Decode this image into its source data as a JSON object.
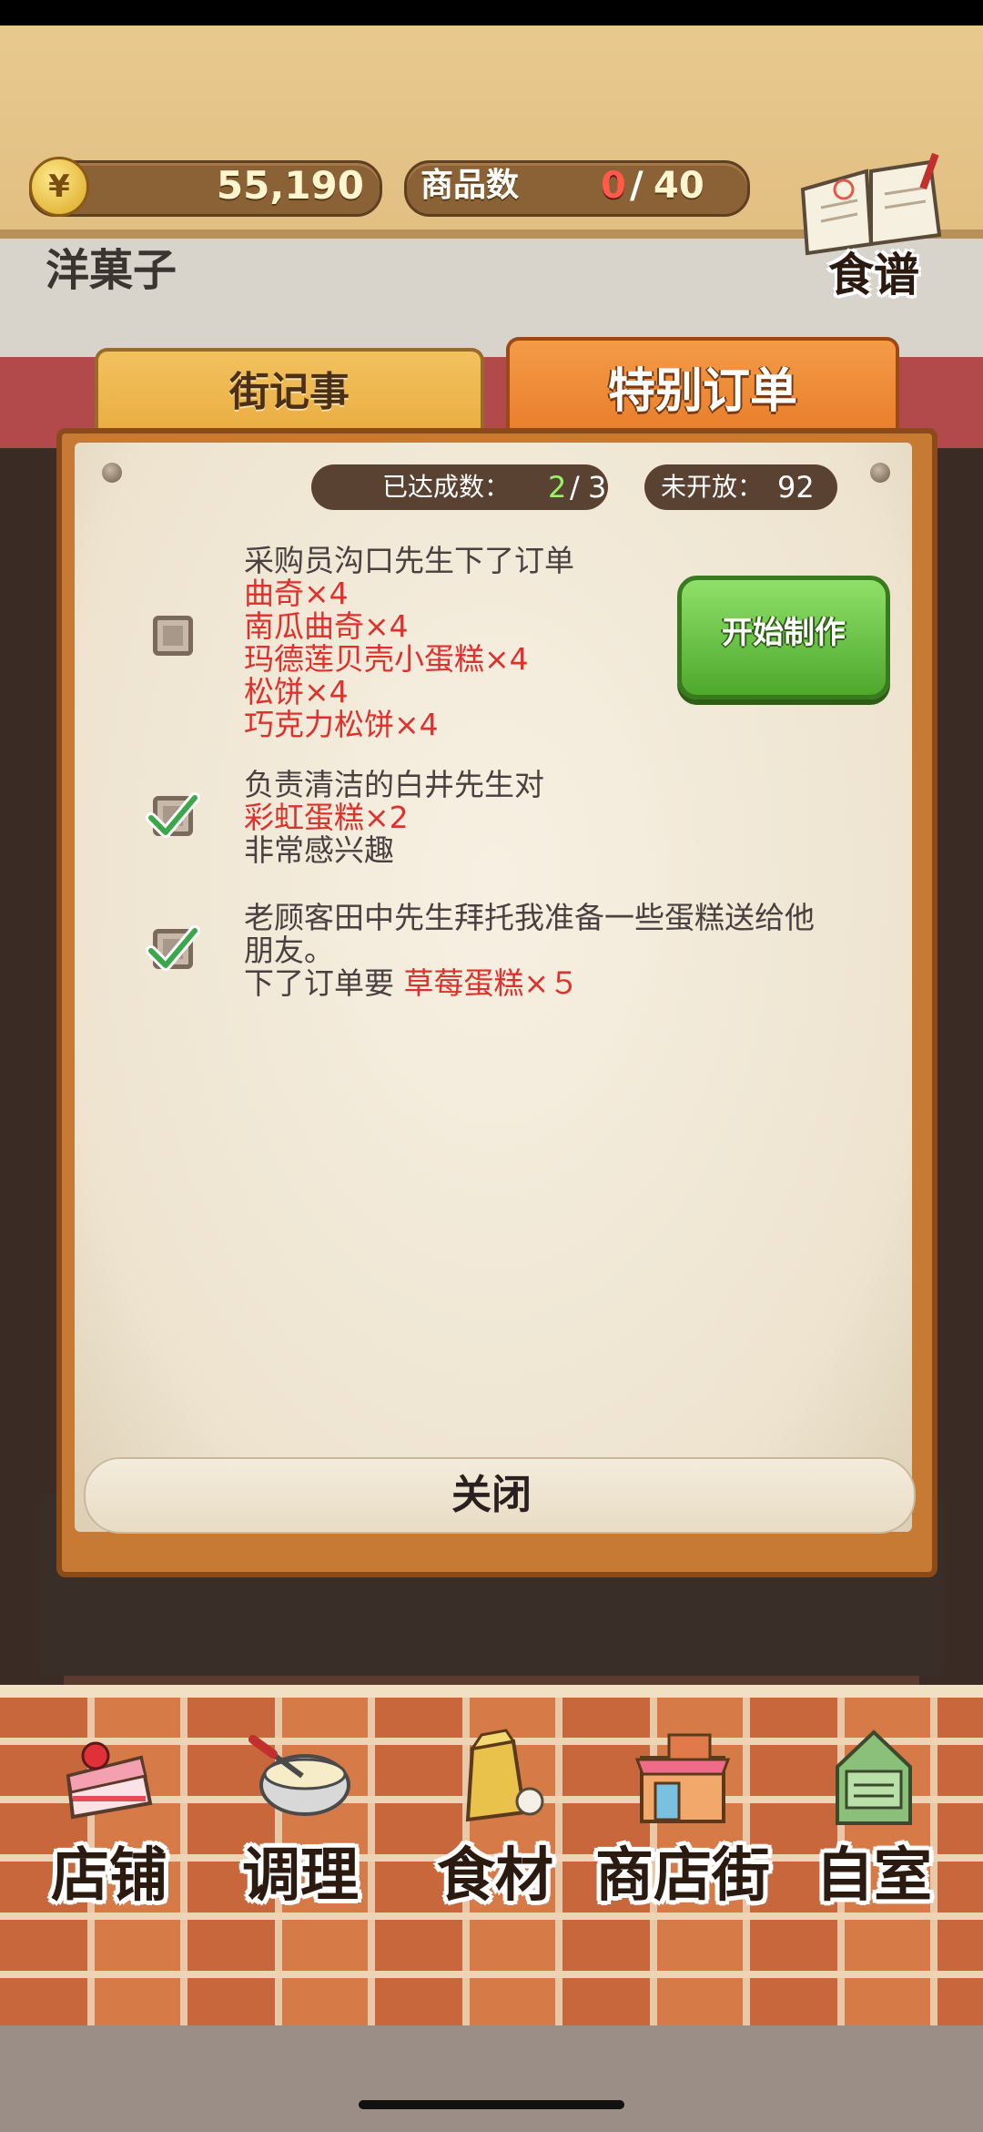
{
  "header": {
    "currency_symbol": "¥",
    "money": "55,190",
    "product_count_label": "商品数",
    "product_count_current": "0",
    "product_count_separator": "/",
    "product_count_total": "40",
    "recipe_label": "食谱"
  },
  "storefront": {
    "sign": "洋菓子"
  },
  "tabs": {
    "street": "街记事",
    "special": "特别订单"
  },
  "stats": {
    "done_label": "已达成数：",
    "done_count": "2",
    "done_separator": "/",
    "done_total": "3",
    "locked_label": "未开放：",
    "locked_value": "92"
  },
  "orders": [
    {
      "intro": "采购员沟口先生下了订单",
      "items": [
        "曲奇×4",
        "南瓜曲奇×4",
        "玛德莲贝壳小蛋糕×4",
        "松饼×4",
        "巧克力松饼×4"
      ],
      "completed": false
    },
    {
      "intro": "负责清洁的白井先生对",
      "items": [
        "彩虹蛋糕×2"
      ],
      "outro": "非常感兴趣",
      "completed": true
    },
    {
      "intro": "老顾客田中先生拜托我准备一些蛋糕送给他",
      "intro2": "朋友。",
      "prefix": "下了订单要",
      "items": [
        "草莓蛋糕×５"
      ],
      "completed": true
    }
  ],
  "start_button": "开始制作",
  "close_button": "关闭",
  "nav": [
    {
      "label": "店铺",
      "icon": "cake-icon"
    },
    {
      "label": "调理",
      "icon": "mixing-bowl-icon"
    },
    {
      "label": "食材",
      "icon": "flour-bag-icon"
    },
    {
      "label": "商店街",
      "icon": "shop-icon"
    },
    {
      "label": "自室",
      "icon": "staff-door-icon"
    }
  ],
  "colors": {
    "accent_orange": "#e67826",
    "item_red": "#e0302c",
    "start_green": "#4ea82c"
  }
}
